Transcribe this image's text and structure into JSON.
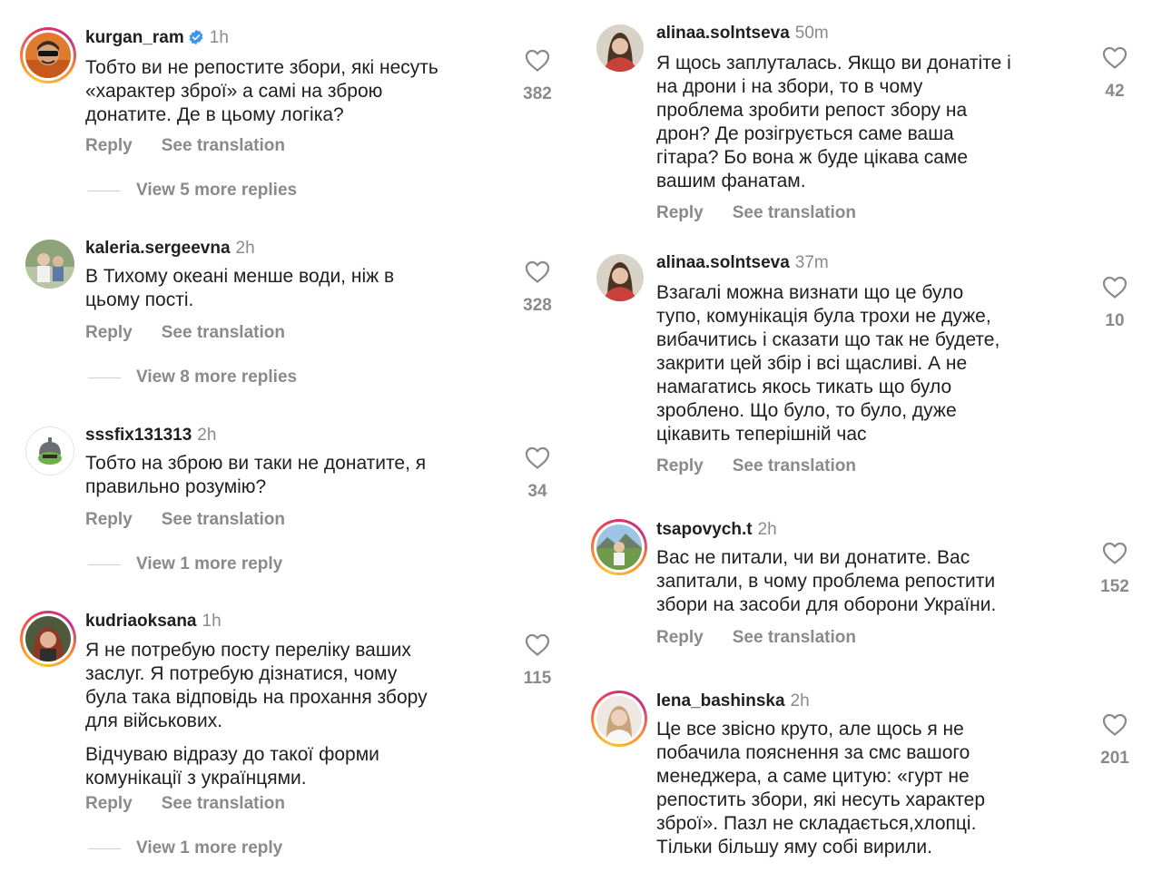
{
  "labels": {
    "reply": "Reply",
    "see_translation": "See translation"
  },
  "colors": {
    "text": "#1f1f1f",
    "muted": "#8a8a8a",
    "verified": "#3797f0",
    "story_ring": [
      "#fdc52f",
      "#f77737",
      "#e1306c",
      "#c13584"
    ]
  },
  "comments": [
    {
      "username": "kurgan_ram",
      "verified": true,
      "time": "1h",
      "lines": [
        "Тобто ви не репостите збори, які несуть",
        "«характер зброї» а самі на зброю",
        "донатите. Де в цьому логіка?"
      ],
      "likes": "382",
      "view_more": "View 5 more replies"
    },
    {
      "username": "kaleria.sergeevna",
      "time": "2h",
      "lines": [
        "В Тихому океані менше води, ніж в",
        "цьому пості."
      ],
      "likes": "328",
      "view_more": "View 8 more replies"
    },
    {
      "username": "sssfix131313",
      "time": "2h",
      "lines": [
        "Тобто на зброю ви таки не донатите, я",
        "правильно розумію?"
      ],
      "likes": "34",
      "view_more": "View 1 more reply"
    },
    {
      "username": "kudriaoksana",
      "time": "1h",
      "lines": [
        "Я не потребую посту переліку ваших",
        "заслуг. Я потребую дізнатися, чому",
        "була така відповідь на прохання збору",
        "для військових."
      ],
      "lines2": [
        "Відчуваю відразу до такої форми",
        "комунікації з українцями."
      ],
      "likes": "115",
      "view_more": "View 1 more reply"
    },
    {
      "username": "alinaa.solntseva",
      "time": "50m",
      "lines": [
        "Я щось заплуталась. Якщо ви донатіте і",
        "на дрони і на збори, то в чому",
        "проблема зробити репост збору на",
        "дрон? Де розігрується саме ваша",
        "гітара? Бо вона ж буде цікава саме",
        "вашим фанатам."
      ],
      "likes": "42"
    },
    {
      "username": "alinaa.solntseva",
      "time": "37m",
      "lines": [
        "Взагалі можна визнати що це було",
        "тупо, комунікація була трохи не дуже,",
        "вибачитись і сказати що так не будете,",
        "закрити цей збір і всі щасливі. А не",
        "намагатись якось тикать що було",
        "зроблено. Що було, то було, дуже",
        "цікавить теперішній час"
      ],
      "likes": "10"
    },
    {
      "username": "tsapovych.t",
      "time": "2h",
      "lines": [
        "Вас не питали, чи ви донатите. Вас",
        "запитали, в чому проблема репостити",
        "збори на засоби для оборони України."
      ],
      "likes": "152"
    },
    {
      "username": "lena_bashinska",
      "time": "2h",
      "lines": [
        "Це все звісно круто, але щось я не",
        "побачила пояснення за смс вашого",
        "менеджера, а саме цитую: «гурт не",
        "репостить збори, які несуть характер",
        "зброї». Пазл не складається,хлопці.",
        "Тільки більшу яму собі вирили."
      ],
      "likes": "201"
    }
  ]
}
